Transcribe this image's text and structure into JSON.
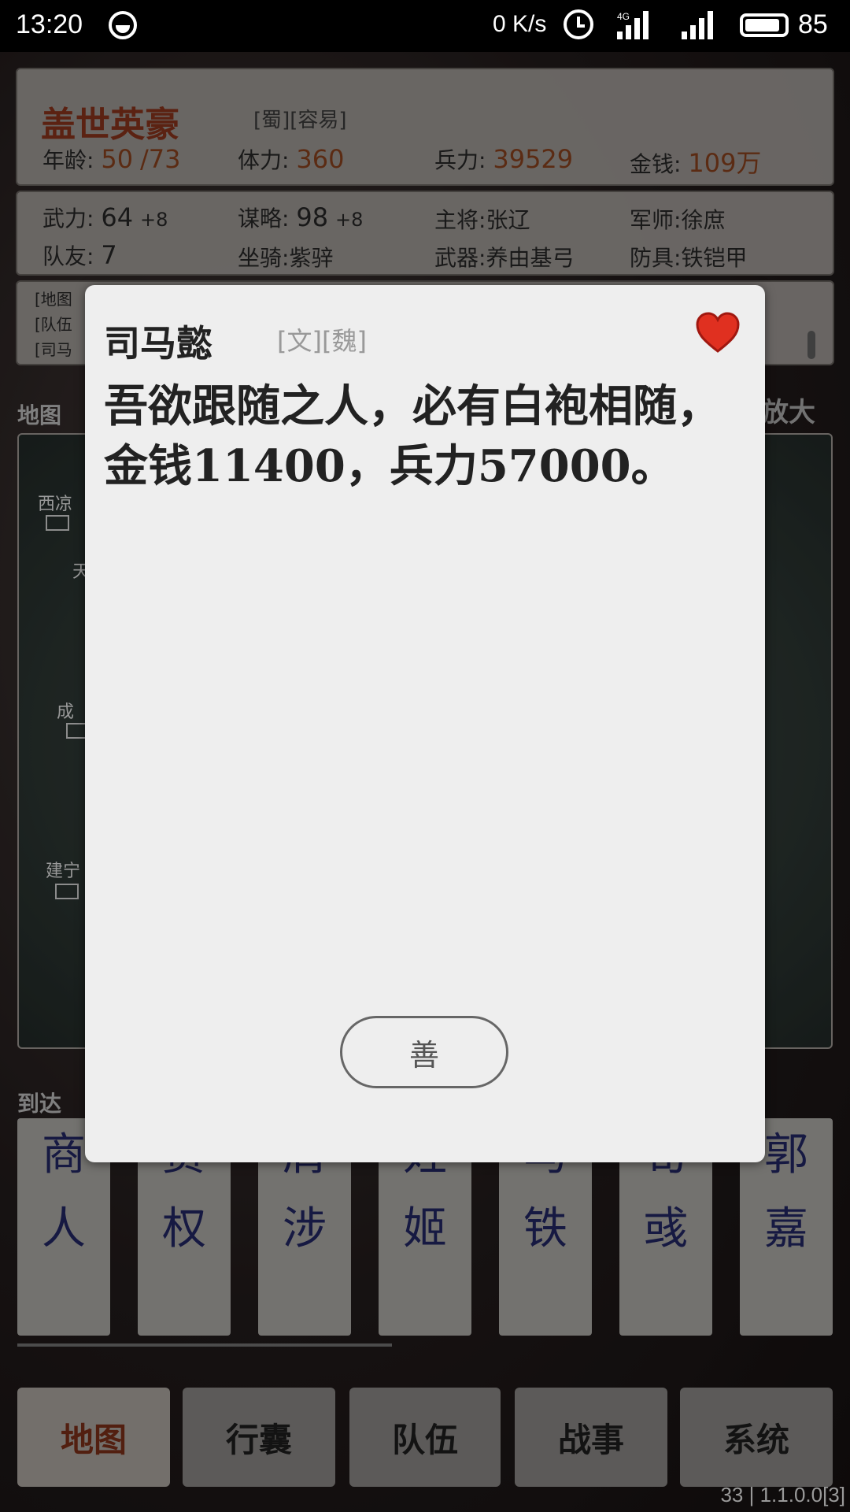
{
  "status_bar": {
    "time": "13:20",
    "net_speed": "0 K/s",
    "lte": "4G",
    "battery": "85"
  },
  "hero": {
    "title": "盖世英豪",
    "tags": "[蜀][容易]",
    "age_label": "年龄:",
    "age_value": "50",
    "age_max": "/73",
    "stamina_label": "体力:",
    "stamina_value": "360",
    "troops_label": "兵力:",
    "troops_value": "39529",
    "money_label": "金钱:",
    "money_value": "109万"
  },
  "attributes": {
    "force_label": "武力:",
    "force_value": "64",
    "force_bonus": "+8",
    "strategy_label": "谋略:",
    "strategy_value": "98",
    "strategy_bonus": "+8",
    "general_label": "主将:",
    "general_value": "张辽",
    "advisor_label": "军师:",
    "advisor_value": "徐庶",
    "teammates_label": "队友:",
    "teammates_value": "7",
    "mount_label": "坐骑:",
    "mount_value": "紫骍",
    "weapon_label": "武器:",
    "weapon_value": "养由基弓",
    "armor_label": "防具:",
    "armor_value": "铁铠甲"
  },
  "log": {
    "line1": "[地图",
    "line2": "[队伍",
    "line3": "[司马"
  },
  "map": {
    "label": "地图",
    "zoom_label": "放大",
    "cities": [
      "西凉",
      "天",
      "成",
      "建宁"
    ]
  },
  "arrive_label": "到达",
  "characters": [
    {
      "top": "商",
      "bottom": "人"
    },
    {
      "top": "贾",
      "bottom": "权"
    },
    {
      "top": "屑",
      "bottom": "涉"
    },
    {
      "top": "姓",
      "bottom": "姬"
    },
    {
      "top": "马",
      "bottom": "铁"
    },
    {
      "top": "荀",
      "bottom": "彧"
    },
    {
      "top": "郭",
      "bottom": "嘉"
    }
  ],
  "nav": {
    "map": "地图",
    "bag": "行囊",
    "team": "队伍",
    "battle": "战事",
    "system": "系统"
  },
  "version": "33 | 1.1.0.0[3]",
  "dialog": {
    "name": "司马懿",
    "tags": "[文][魏]",
    "message": "吾欲跟随之人，必有白袍相随，金钱11400，兵力57000。",
    "ok_label": "善"
  }
}
